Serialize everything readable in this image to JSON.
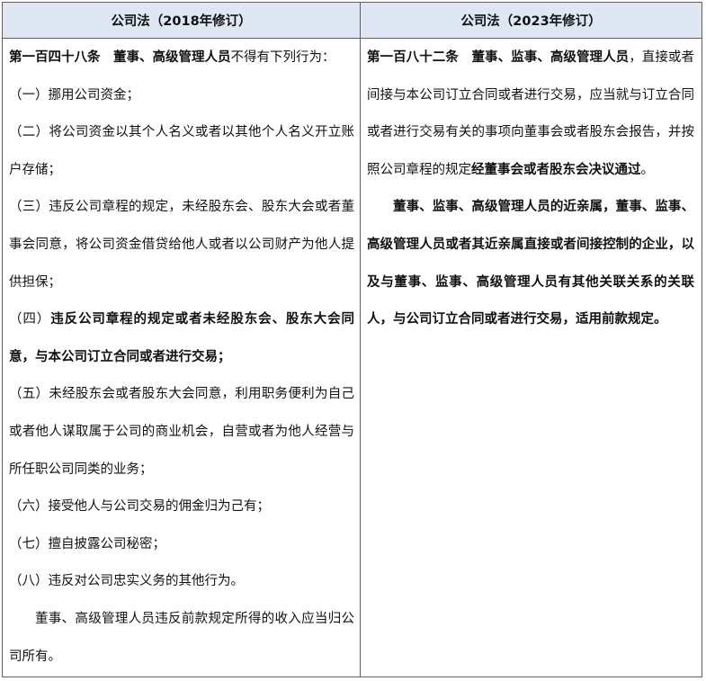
{
  "columns": {
    "left_header": "公司法（2018年修订）",
    "right_header": "公司法（2023年修订）"
  },
  "left": {
    "p1_bold": "第一百四十八条　董事、高级管理人员",
    "p1_rest": "不得有下列行为：",
    "item1": "（一）挪用公司资金；",
    "item2": "（二）将公司资金以其个人名义或者以其他个人名义开立账户存储；",
    "item3": "（三）违反公司章程的规定，未经股东会、股东大会或者董事会同意，将公司资金借贷给他人或者以公司财产为他人提供担保；",
    "item4_prefix": "（四）",
    "item4_bold": "违反公司章程的规定或者未经股东会、股东大会同意，与本公司订立合同或者进行交易；",
    "item5": "（五）未经股东会或者股东大会同意，利用职务便利为自己或者他人谋取属于公司的商业机会，自营或者为他人经营与所任职公司同类的业务；",
    "item6": "（六）接受他人与公司交易的佣金归为己有；",
    "item7": "（七）擅自披露公司秘密；",
    "item8": "（八）违反对公司忠实义务的其他行为。",
    "closing": "董事、高级管理人员违反前款规定所得的收入应当归公司所有。"
  },
  "right": {
    "p1_bold": "第一百八十二条　董事、监事、高级管理人员",
    "p1_mid": "，直接或者间接与本公司订立合同或者进行交易，应当就与订立合同或者进行交易有关的事项向董事会或者股东会报告，并按照公司章程的规定",
    "p1_bold_end": "经董事会或者股东会决议通过",
    "p1_end": "。",
    "p2_bold": "董事、监事、高级管理人员的近亲属，董事、监事、高级管理人员或者其近亲属直接或者间接控制的企业，以及与董事、监事、高级管理人员有其他关联关系的关联人，与公司订立合同或者进行交易，适用前款规定。"
  }
}
